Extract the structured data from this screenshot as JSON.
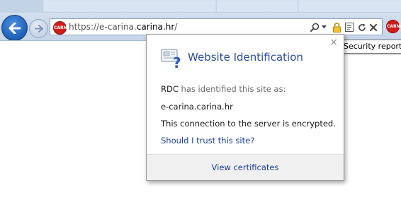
{
  "toolbar": {
    "url_prefix": "https://e-carina.",
    "url_domain": "carina.hr",
    "url_suffix": "/",
    "favicon_text": "CARNet",
    "security_tooltip": "Security report",
    "icons": [
      "back-arrow-icon",
      "forward-arrow-icon",
      "search-icon",
      "dropdown-icon",
      "lock-icon",
      "compatibility-view-icon",
      "refresh-icon",
      "stop-icon"
    ]
  },
  "popup": {
    "title": "Website Identification",
    "issuer": "RDC",
    "issuer_text": "has identified this site as:",
    "site": "e-carina.carina.hr",
    "encryption_text": "This connection to the server is encrypted.",
    "trust_link": "Should I trust this site?",
    "view_certificates": "View certificates",
    "close": "×"
  },
  "colors": {
    "link_blue": "#1a3f9a",
    "title_blue": "#2a4e9a",
    "back_button": "#1e5fb8",
    "site_badge": "#d21c1c"
  }
}
